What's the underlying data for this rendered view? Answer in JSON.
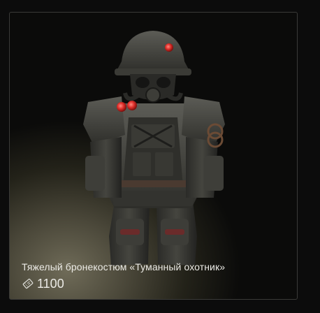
{
  "item": {
    "name": "Тяжелый бронекостюм «Туманный охотник»",
    "price": "1100",
    "currency_icon": "coupon-icon",
    "image_subject": "heavy-armor-suit-illustration"
  },
  "colors": {
    "text": "#ecebe6",
    "card_border": "#3a3a38",
    "background_glow": "#6f6b58",
    "lens_red": "#e0302c"
  }
}
